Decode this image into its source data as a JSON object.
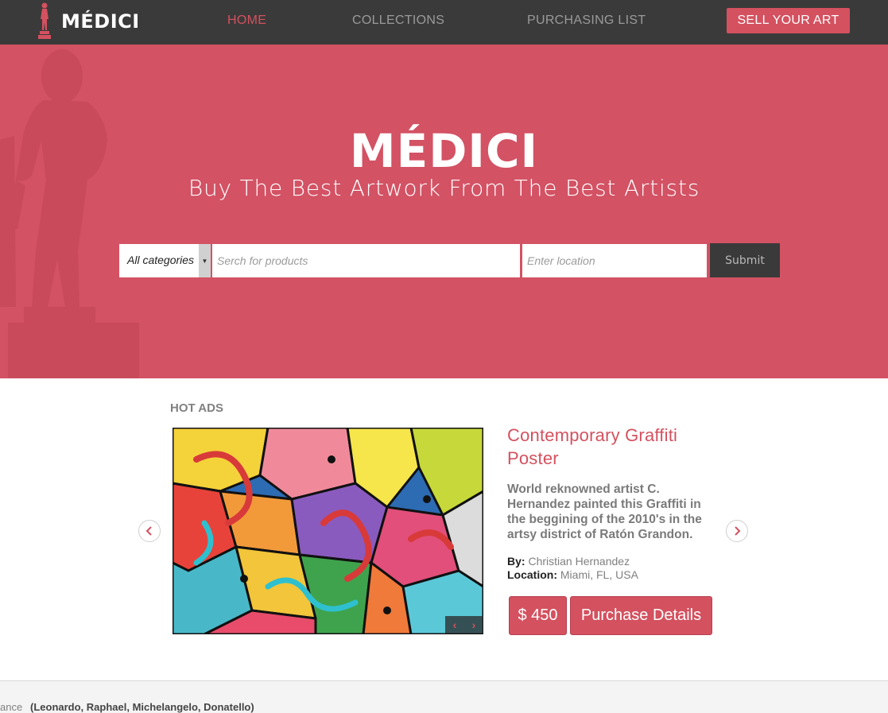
{
  "nav": {
    "brand": "MÉDICI",
    "links": [
      {
        "label": "HOME",
        "active": true
      },
      {
        "label": "COLLECTIONS",
        "active": false
      },
      {
        "label": "PURCHASING LIST",
        "active": false
      }
    ],
    "sell_label": "SELL YOUR ART"
  },
  "hero": {
    "title": "MÉDICI",
    "subtitle": "Buy The Best Artwork From The Best Artists",
    "search": {
      "category": "All categories",
      "product_placeholder": "Serch for products",
      "location_placeholder": "Enter location",
      "submit_label": "Submit"
    }
  },
  "hot_ads": {
    "heading": "HOT ADS",
    "item": {
      "title": "Contemporary Graffiti Poster",
      "description": "World reknowned artist C. Hernandez painted this Graffiti in the beggining of the 2010's in the artsy district of Ratón Grandon.",
      "by_label": "By:",
      "by_value": "Christian Hernandez",
      "location_label": "Location:",
      "location_value": "Miami, FL, USA",
      "price": "$ 450",
      "details_label": "Purchase Details"
    }
  },
  "footer": {
    "cut_text": "ance",
    "names": "(Leonardo, Raphael, Michelangelo, Donatello)"
  },
  "colors": {
    "brand": "#d4515f",
    "hero_bg": "#d35264",
    "nav_bg": "#3a3a3a"
  },
  "icons": [
    "statue-logo-icon",
    "chevron-left-icon",
    "chevron-right-icon",
    "dropdown-caret-icon"
  ]
}
